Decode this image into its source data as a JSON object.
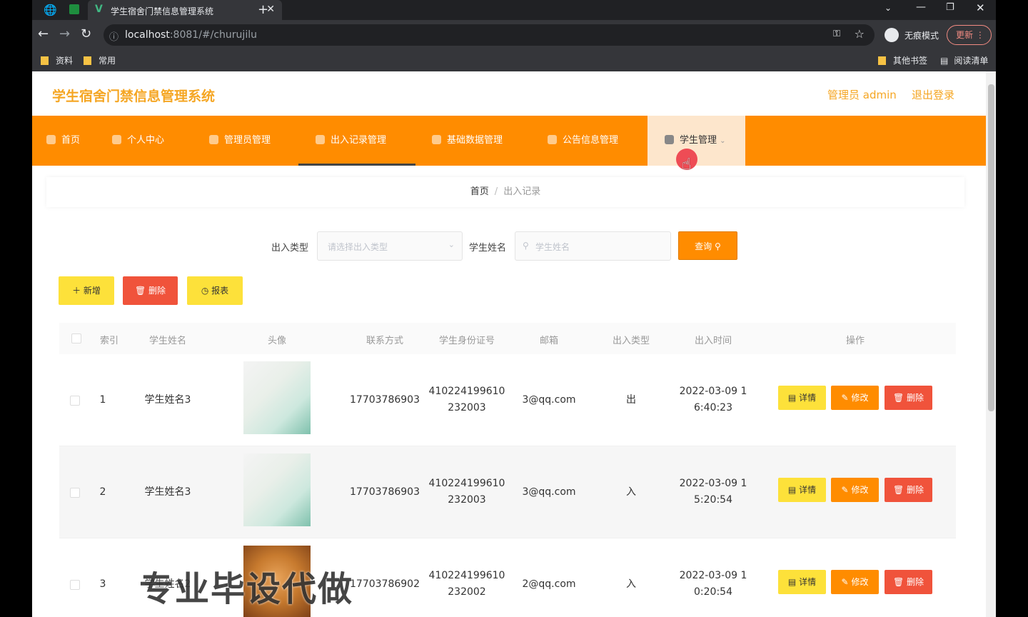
{
  "browser": {
    "tab_title": "学生宿舍门禁信息管理系统",
    "url_host": "localhost",
    "url_rest": ":8081/#/churujilu",
    "incognito_label": "无痕模式",
    "update_label": "更新",
    "bookmarks": [
      "资料",
      "常用"
    ],
    "other_bookmarks": "其他书签",
    "reading_list": "阅读清单"
  },
  "header": {
    "site_title": "学生宿舍门禁信息管理系统",
    "admin_label": "管理员 admin",
    "logout_label": "退出登录"
  },
  "nav": {
    "items": [
      "首页",
      "个人中心",
      "管理员管理",
      "出入记录管理",
      "基础数据管理",
      "公告信息管理",
      "学生管理"
    ]
  },
  "breadcrumb": {
    "home": "首页",
    "sep": "/",
    "current": "出入记录"
  },
  "search": {
    "type_label": "出入类型",
    "type_placeholder": "请选择出入类型",
    "name_label": "学生姓名",
    "name_placeholder": "学生姓名",
    "query_label": "查询"
  },
  "actions": {
    "add": "新增",
    "delete": "删除",
    "report": "报表"
  },
  "table": {
    "headers": [
      "索引",
      "学生姓名",
      "头像",
      "联系方式",
      "学生身份证号",
      "邮箱",
      "出入类型",
      "出入时间",
      "操作"
    ],
    "rows": [
      {
        "index": "1",
        "name": "学生姓名3",
        "phone": "17703786903",
        "id_line1": "410224199610",
        "id_line2": "232003",
        "email": "3@qq.com",
        "type": "出",
        "time_line1": "2022-03-09 1",
        "time_line2": "6:40:23"
      },
      {
        "index": "2",
        "name": "学生姓名3",
        "phone": "17703786903",
        "id_line1": "410224199610",
        "id_line2": "232003",
        "email": "3@qq.com",
        "type": "入",
        "time_line1": "2022-03-09 1",
        "time_line2": "5:20:54"
      },
      {
        "index": "3",
        "name": "学生姓名2",
        "phone": "17703786902",
        "id_line1": "410224199610",
        "id_line2": "232002",
        "email": "2@qq.com",
        "type": "入",
        "time_line1": "2022-03-09 1",
        "time_line2": "0:20:54"
      }
    ],
    "row_actions": {
      "detail": "详情",
      "edit": "修改",
      "delete": "删除"
    }
  },
  "watermark": "专业毕设代做"
}
